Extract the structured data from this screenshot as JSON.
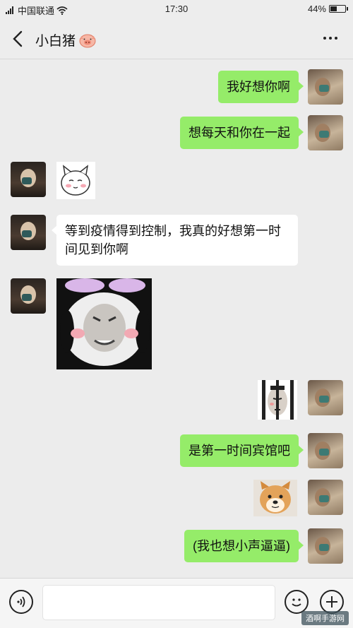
{
  "status_bar": {
    "carrier": "中国联通",
    "time": "17:30",
    "battery_percent": "44%",
    "battery_level": 0.44,
    "icons": [
      "signal-icon",
      "wifi-icon",
      "battery-icon"
    ]
  },
  "header": {
    "title": "小白猪",
    "title_emoji": "pig-face-icon",
    "back_icon": "chevron-left-icon",
    "more_icon": "more-dots-icon"
  },
  "messages": [
    {
      "sender": "me",
      "type": "text",
      "text": "我好想你啊"
    },
    {
      "sender": "me",
      "type": "text",
      "text": "想每天和你在一起"
    },
    {
      "sender": "other",
      "type": "sticker",
      "sticker": "cute-shy-face-sticker"
    },
    {
      "sender": "other",
      "type": "text",
      "text": "等到疫情得到控制，我真的好想第一时间见到你啊"
    },
    {
      "sender": "other",
      "type": "sticker",
      "sticker": "panda-face-sticker"
    },
    {
      "sender": "me",
      "type": "sticker",
      "sticker": "behind-bars-sticker"
    },
    {
      "sender": "me",
      "type": "text",
      "text": "是第一时间宾馆吧"
    },
    {
      "sender": "me",
      "type": "sticker",
      "sticker": "shiba-dog-sticker"
    },
    {
      "sender": "me",
      "type": "text",
      "text": "(我也想小声逼逼)"
    }
  ],
  "input_bar": {
    "value": "",
    "voice_icon": "voice-icon",
    "emoji_icon": "emoji-icon",
    "plus_icon": "plus-icon"
  },
  "watermark": "酒啊手游网",
  "colors": {
    "my_bubble": "#95ec69",
    "other_bubble": "#ffffff",
    "background": "#ececec"
  }
}
